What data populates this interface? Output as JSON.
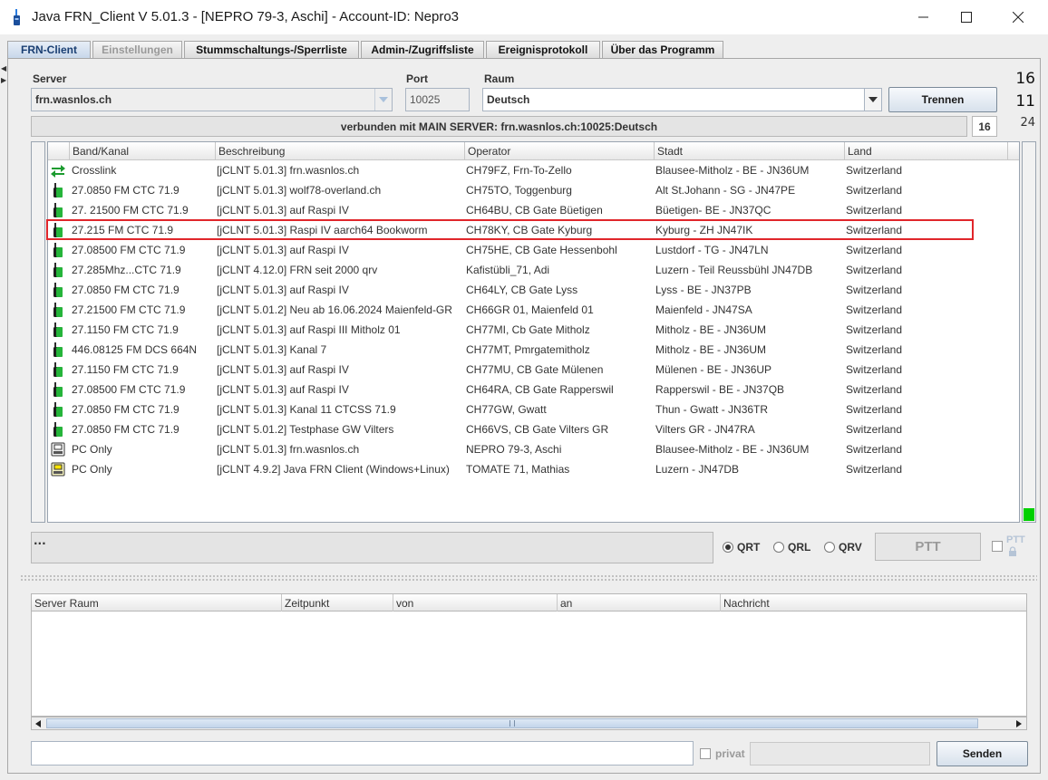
{
  "window": {
    "title": "Java FRN_Client V 5.01.3 - [NEPRO 79-3, Aschi] - Account-ID: Nepro3",
    "minimize_icon": "minimize-icon",
    "maximize_icon": "maximize-icon",
    "close_icon": "close-icon"
  },
  "tabs": [
    {
      "label": "FRN-Client",
      "state": "active"
    },
    {
      "label": "Einstellungen",
      "state": "disabled"
    },
    {
      "label": "Stummschaltungs-/Sperrliste",
      "state": "normal"
    },
    {
      "label": "Admin-/Zugriffsliste",
      "state": "normal"
    },
    {
      "label": "Ereignisprotokoll",
      "state": "normal"
    },
    {
      "label": "Über das Programm",
      "state": "normal"
    }
  ],
  "server": {
    "server_label": "Server",
    "server_value": "frn.wasnlos.ch",
    "port_label": "Port",
    "port_value": "10025",
    "room_label": "Raum",
    "room_value": "Deutsch",
    "disconnect_button": "Trennen",
    "status_text": "verbunden mit  MAIN SERVER: frn.wasnlos.ch:10025:Deutsch",
    "count_box": "16"
  },
  "side_counts": {
    "top": "16",
    "middle": "11",
    "bottom": "24"
  },
  "clients_table": {
    "columns": [
      "Band/Kanal",
      "Beschreibung",
      "Operator",
      "Stadt",
      "Land"
    ],
    "rows": [
      {
        "icon": "crosslink-icon",
        "band": "Crosslink",
        "desc": "[jCLNT 5.01.3] frn.wasnlos.ch",
        "operator": "CH79FZ, Frn-To-Zello",
        "city": "Blausee-Mitholz - BE - JN36UM",
        "country": "Switzerland"
      },
      {
        "icon": "radio-gateway-icon",
        "band": "27.0850 FM CTC 71.9",
        "desc": "[jCLNT 5.01.3] wolf78-overland.ch",
        "operator": "CH75TO, Toggenburg",
        "city": "Alt St.Johann - SG - JN47PE",
        "country": "Switzerland"
      },
      {
        "icon": "radio-gateway-icon",
        "band": "27. 21500 FM CTC 71.9",
        "desc": "[jCLNT 5.01.3] auf Raspi IV",
        "operator": "CH64BU, CB Gate Büetigen",
        "city": "Büetigen- BE - JN37QC",
        "country": "Switzerland"
      },
      {
        "icon": "radio-gateway-icon",
        "band": "27.215 FM CTC 71.9",
        "desc": "[jCLNT 5.01.3] Raspi IV aarch64 Bookworm",
        "operator": "CH78KY, CB Gate Kyburg",
        "city": "Kyburg - ZH JN47IK",
        "country": "Switzerland"
      },
      {
        "icon": "radio-gateway-icon",
        "band": "27.08500 FM CTC 71.9",
        "desc": "[jCLNT 5.01.3] auf Raspi IV",
        "operator": "CH75HE, CB Gate Hessenbohl",
        "city": "Lustdorf - TG - JN47LN",
        "country": "Switzerland"
      },
      {
        "icon": "radio-gateway-icon",
        "band": "27.285Mhz...CTC 71.9",
        "desc": "[jCLNT 4.12.0] FRN seit 2000 qrv",
        "operator": "Kafistübli_71, Adi",
        "city": "Luzern - Teil Reussbühl JN47DB",
        "country": "Switzerland"
      },
      {
        "icon": "radio-gateway-icon",
        "band": "27.0850 FM CTC 71.9",
        "desc": "[jCLNT 5.01.3] auf Raspi IV",
        "operator": "CH64LY, CB Gate Lyss",
        "city": "Lyss - BE - JN37PB",
        "country": "Switzerland"
      },
      {
        "icon": "radio-gateway-icon",
        "band": "27.21500 FM CTC 71.9",
        "desc": "[jCLNT 5.01.2] Neu ab 16.06.2024  Maienfeld-GR",
        "operator": "CH66GR 01, Maienfeld 01",
        "city": "Maienfeld - JN47SA",
        "country": "Switzerland"
      },
      {
        "icon": "radio-gateway-icon",
        "band": "27.1150 FM CTC 71.9",
        "desc": "[jCLNT 5.01.3] auf Raspi III  Mitholz 01",
        "operator": "CH77MI, Cb Gate Mitholz",
        "city": "Mitholz - BE - JN36UM",
        "country": "Switzerland"
      },
      {
        "icon": "radio-gateway-icon",
        "band": "446.08125 FM DCS 664N",
        "desc": "[jCLNT 5.01.3] Kanal 7",
        "operator": "CH77MT, Pmrgatemitholz",
        "city": "Mitholz - BE - JN36UM",
        "country": "Switzerland"
      },
      {
        "icon": "radio-gateway-icon",
        "band": "27.1150 FM CTC 71.9",
        "desc": "[jCLNT 5.01.3] auf Raspi IV",
        "operator": "CH77MU, CB Gate Mülenen",
        "city": "Mülenen - BE - JN36UP",
        "country": "Switzerland"
      },
      {
        "icon": "radio-gateway-icon",
        "band": "27.08500 FM CTC 71.9",
        "desc": "[jCLNT 5.01.3] auf Raspi IV",
        "operator": "CH64RA, CB Gate Rapperswil",
        "city": "Rapperswil - BE - JN37QB",
        "country": "Switzerland"
      },
      {
        "icon": "radio-gateway-icon",
        "band": "27.0850 FM CTC 71.9",
        "desc": "[jCLNT 5.01.3] Kanal 11 CTCSS 71.9",
        "operator": "CH77GW, Gwatt",
        "city": "Thun - Gwatt - JN36TR",
        "country": "Switzerland"
      },
      {
        "icon": "radio-gateway-icon",
        "band": "27.0850 FM CTC 71.9",
        "desc": "[jCLNT 5.01.2] Testphase GW Vilters",
        "operator": "CH66VS, CB Gate Vilters GR",
        "city": "Vilters GR - JN47RA",
        "country": "Switzerland"
      },
      {
        "icon": "pc-only-icon",
        "band": "PC Only",
        "desc": "[jCLNT 5.01.3] frn.wasnlos.ch",
        "operator": "NEPRO 79-3, Aschi",
        "city": "Blausee-Mitholz - BE - JN36UM",
        "country": "Switzerland"
      },
      {
        "icon": "pc-only-active-icon",
        "band": "PC Only",
        "desc": "[jCLNT 4.9.2] Java FRN Client (Windows+Linux)",
        "operator": "TOMATE  71, Mathias",
        "city": "Luzern - JN47DB",
        "country": "Switzerland"
      }
    ]
  },
  "ptt_area": {
    "info_text": "...",
    "radio_options": [
      {
        "label": "QRT",
        "selected": true
      },
      {
        "label": "QRL",
        "selected": false
      },
      {
        "label": "QRV",
        "selected": false
      }
    ],
    "ptt_button": "PTT",
    "ptt_lock_label": "PTT"
  },
  "messages": {
    "columns": [
      "Server Raum",
      "Zeitpunkt",
      "von",
      "an",
      "Nachricht"
    ],
    "input_value": "",
    "private_label": "privat",
    "send_button": "Senden"
  },
  "colors": {
    "highlight": "#e0262b",
    "level_indicator": "#00d000"
  }
}
